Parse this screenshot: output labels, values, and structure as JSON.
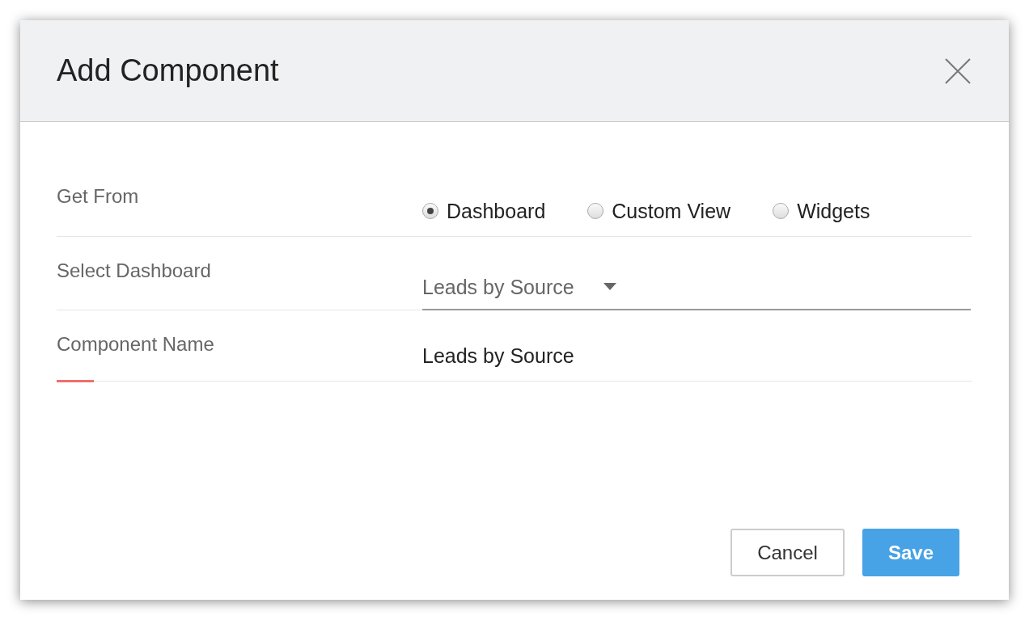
{
  "dialog": {
    "title": "Add Component"
  },
  "fields": [
    {
      "kind": "radio",
      "label": "Get From",
      "focused": false,
      "options": [
        {
          "label": "Dashboard",
          "selected": true
        },
        {
          "label": "Custom View",
          "selected": false
        },
        {
          "label": "Widgets",
          "selected": false
        }
      ]
    },
    {
      "kind": "select",
      "label": "Select Dashboard",
      "focused": false,
      "value": "Leads by Source"
    },
    {
      "kind": "text",
      "label": "Component Name",
      "focused": true,
      "value": "Leads by Source"
    }
  ],
  "buttons": [
    {
      "label": "Cancel",
      "kind": "secondary"
    },
    {
      "label": "Save",
      "kind": "primary"
    }
  ]
}
